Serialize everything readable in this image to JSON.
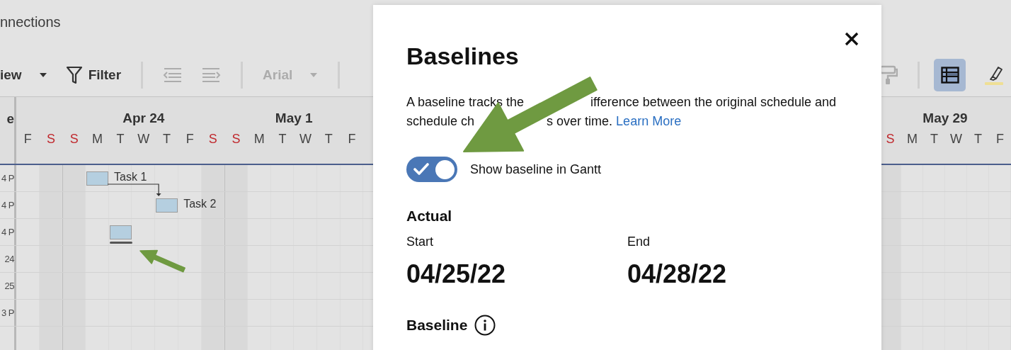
{
  "app_title": "nnections",
  "toolbar_left": [
    [
      {
        "kind": "view_menu",
        "label": "iew",
        "disabled": false
      },
      {
        "kind": "filter",
        "label": "Filter",
        "disabled": false
      }
    ],
    [
      {
        "kind": "outdent",
        "disabled": true
      },
      {
        "kind": "indent",
        "disabled": true
      }
    ],
    [
      {
        "kind": "font_menu",
        "label": "Arial",
        "disabled": true
      }
    ]
  ],
  "toolbar_right": [
    [
      {
        "kind": "paint_format",
        "disabled": true
      }
    ],
    [
      {
        "kind": "grid_view",
        "disabled": false,
        "selected": true
      },
      {
        "kind": "highlight",
        "disabled": false
      }
    ]
  ],
  "gantt": {
    "column_header": "e",
    "days_left": [
      {
        "letter": "F",
        "weekend": false
      },
      {
        "letter": "S",
        "weekend": true
      },
      {
        "letter": "S",
        "weekend": true,
        "week_label": "Apr 24"
      },
      {
        "letter": "M",
        "weekend": false
      },
      {
        "letter": "T",
        "weekend": false
      },
      {
        "letter": "W",
        "weekend": false
      },
      {
        "letter": "T",
        "weekend": false
      },
      {
        "letter": "F",
        "weekend": false
      },
      {
        "letter": "S",
        "weekend": true
      },
      {
        "letter": "S",
        "weekend": true,
        "week_label": "May 1"
      },
      {
        "letter": "M",
        "weekend": false
      },
      {
        "letter": "T",
        "weekend": false
      },
      {
        "letter": "W",
        "weekend": false
      },
      {
        "letter": "T",
        "weekend": false
      },
      {
        "letter": "F",
        "weekend": false
      }
    ],
    "days_right": [
      {
        "letter": "S",
        "weekend": true,
        "week_label": "May 29"
      },
      {
        "letter": "M",
        "weekend": false
      },
      {
        "letter": "T",
        "weekend": false
      },
      {
        "letter": "W",
        "weekend": false
      },
      {
        "letter": "T",
        "weekend": false
      },
      {
        "letter": "F",
        "weekend": false
      }
    ],
    "rows": [
      {
        "label": "4 P",
        "task": "Task 1",
        "linked": true,
        "baseline": false,
        "bar": [
          false,
          false,
          false,
          true,
          false,
          false,
          false,
          false,
          false,
          false,
          false,
          false,
          false,
          false,
          false
        ]
      },
      {
        "label": "4 P",
        "task": "Task 2",
        "linked": false,
        "baseline": false,
        "bar": [
          false,
          false,
          false,
          false,
          false,
          false,
          true,
          false,
          false,
          false,
          false,
          false,
          false,
          false,
          false
        ]
      },
      {
        "label": "4 P",
        "linked": false,
        "baseline": true,
        "bar": [
          false,
          false,
          false,
          false,
          true,
          false,
          false,
          false,
          false,
          false,
          false,
          false,
          false,
          false,
          false
        ]
      },
      {
        "label": "24"
      },
      {
        "label": "25"
      },
      {
        "label": "3 P"
      },
      {}
    ]
  },
  "dialog": {
    "title": "Baselines",
    "description_lines": [
      [
        "A baseline tracks the",
        "ifference between the original schedule and"
      ],
      [
        "schedule ch",
        "s over time."
      ]
    ],
    "link": "Learn More",
    "toggle": {
      "label": "Show baseline in Gantt",
      "on": true
    },
    "sections": [
      {
        "title": "Actual",
        "info": false,
        "fields": [
          {
            "label": "Start",
            "value": "04/25/22"
          },
          {
            "label": "End",
            "value": "04/28/22"
          }
        ]
      },
      {
        "title": "Baseline",
        "info": true
      }
    ]
  }
}
